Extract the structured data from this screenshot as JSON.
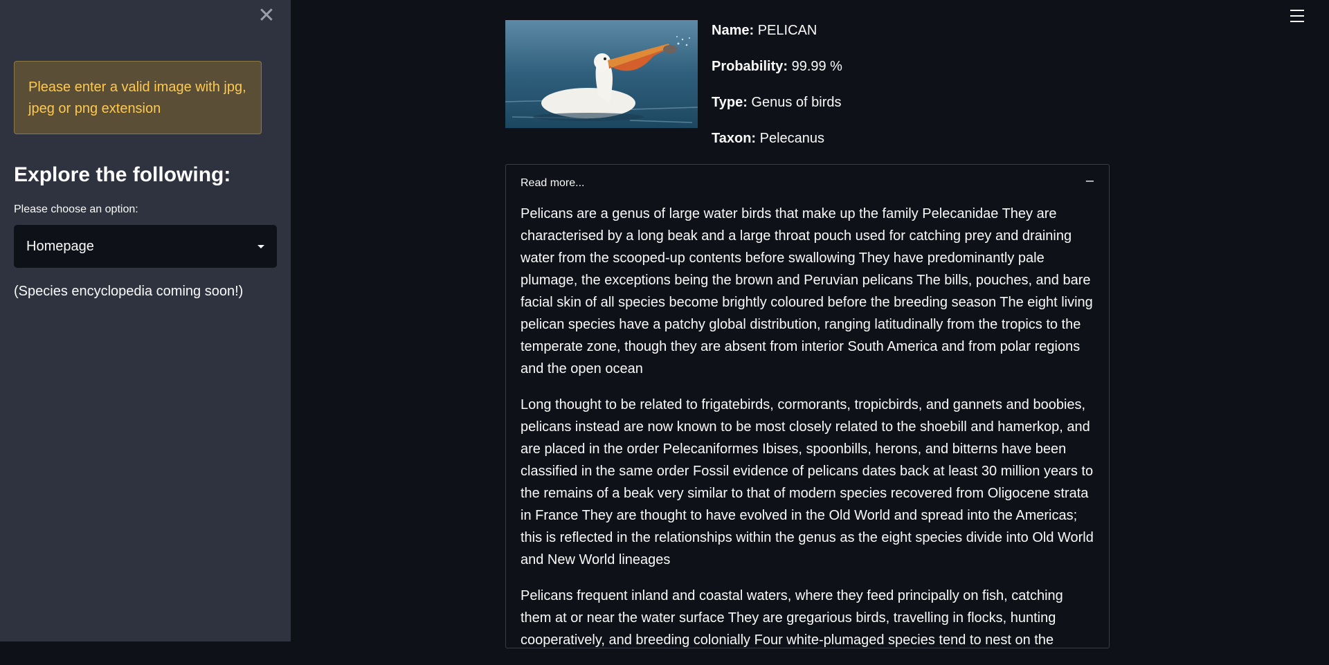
{
  "sidebar": {
    "close_label": "✕",
    "warning": "Please enter a valid image with jpg, jpeg or png extension",
    "heading": "Explore the following:",
    "select_label": "Please choose an option:",
    "select_value": "Homepage",
    "coming_soon": "(Species encyclopedia coming soon!)"
  },
  "result": {
    "name_label": "Name:",
    "name_value": "PELICAN",
    "probability_label": "Probability:",
    "probability_value": "99.99 %",
    "type_label": "Type:",
    "type_value": "Genus of birds",
    "taxon_label": "Taxon:",
    "taxon_value": "Pelecanus"
  },
  "expander": {
    "header": "Read more...",
    "collapse_symbol": "–",
    "paragraphs": [
      "Pelicans are a genus of large water birds that make up the family Pelecanidae They are characterised by a long beak and a large throat pouch used for catching prey and draining water from the scooped-up contents before swallowing They have predominantly pale plumage, the exceptions being the brown and Peruvian pelicans The bills, pouches, and bare facial skin of all species become brightly coloured before the breeding season The eight living pelican species have a patchy global distribution, ranging latitudinally from the tropics to the temperate zone, though they are absent from interior South America and from polar regions and the open ocean",
      "Long thought to be related to frigatebirds, cormorants, tropicbirds, and gannets and boobies, pelicans instead are now known to be most closely related to the shoebill and hamerkop, and are placed in the order Pelecaniformes Ibises, spoonbills, herons, and bitterns have been classified in the same order Fossil evidence of pelicans dates back at least 30 million years to the remains of a beak very similar to that of modern species recovered from Oligocene strata in France They are thought to have evolved in the Old World and spread into the Americas; this is reflected in the relationships within the genus as the eight species divide into Old World and New World lineages",
      "Pelicans frequent inland and coastal waters, where they feed principally on fish, catching them at or near the water surface They are gregarious birds, travelling in flocks, hunting cooperatively, and breeding colonially Four white-plumaged species tend to nest on the"
    ]
  },
  "colors": {
    "sidebar_bg": "#2f3340",
    "main_bg": "#0e1117",
    "warning_text": "#ffc94d",
    "warning_bg": "#5a4f36"
  },
  "icons": {
    "close": "close-icon",
    "menu": "hamburger-menu-icon",
    "dropdown": "chevron-down-icon",
    "collapse": "minus-icon"
  }
}
